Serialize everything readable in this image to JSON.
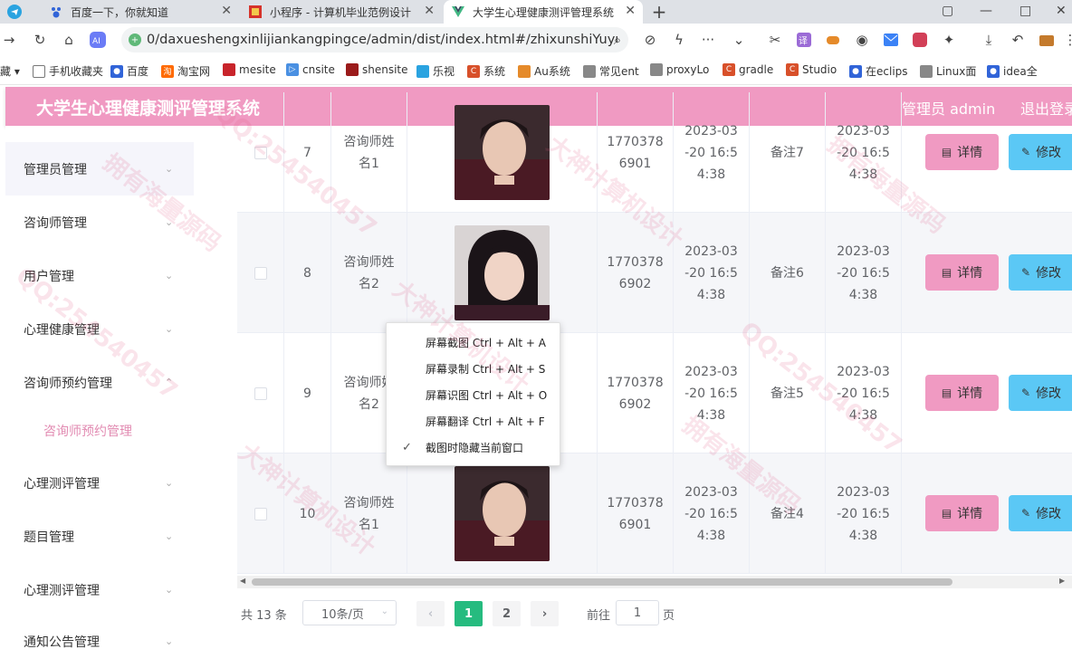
{
  "browser": {
    "tabs": [
      {
        "title": "百度一下，你就知道"
      },
      {
        "title": "小程序 - 计算机毕业范例设计"
      },
      {
        "title": "大学生心理健康测评管理系统"
      }
    ],
    "url": "0/daxueshengxinlijiankangpingce/admin/dist/index.html#/zhixunshiYuyue",
    "bookmarks": [
      "藏",
      "手机收藏夹",
      "百度",
      "淘宝网",
      "mesite",
      "cnsite",
      "shensite",
      "乐视",
      "系统",
      "Au系统",
      "常见ent",
      "proxyLo",
      "gradle",
      "Studio",
      "在eclips",
      "Linux面",
      "idea全"
    ],
    "translate_label": "译"
  },
  "header": {
    "title": "大学生心理健康测评管理系统",
    "admin": "管理员 admin",
    "logout": "退出登录"
  },
  "sidebar": {
    "items": [
      {
        "label": "管理员管理"
      },
      {
        "label": "咨询师管理"
      },
      {
        "label": "用户管理"
      },
      {
        "label": "心理健康管理"
      },
      {
        "label": "咨询师预约管理"
      },
      {
        "label": "咨询师预约管理"
      },
      {
        "label": "心理测评管理"
      },
      {
        "label": "题目管理"
      },
      {
        "label": "心理测评管理"
      },
      {
        "label": "通知公告管理"
      }
    ]
  },
  "table": {
    "rows": [
      {
        "index": "7",
        "name_line1": "咨询师姓",
        "name_line2": "名1",
        "phone_line1": "1770378",
        "phone_line2": "6901",
        "date1_line1": "2023-03",
        "date1_line2": "-20 16:5",
        "date1_line3": "4:38",
        "note": "备注7",
        "date2_line1": "2023-03",
        "date2_line2": "-20 16:5",
        "date2_line3": "4:38"
      },
      {
        "index": "8",
        "name_line1": "咨询师姓",
        "name_line2": "名2",
        "phone_line1": "1770378",
        "phone_line2": "6902",
        "date1_line1": "2023-03",
        "date1_line2": "-20 16:5",
        "date1_line3": "4:38",
        "note": "备注6",
        "date2_line1": "2023-03",
        "date2_line2": "-20 16:5",
        "date2_line3": "4:38"
      },
      {
        "index": "9",
        "name_line1": "咨询师姓",
        "name_line2": "名2",
        "phone_line1": "1770378",
        "phone_line2": "6902",
        "date1_line1": "2023-03",
        "date1_line2": "-20 16:5",
        "date1_line3": "4:38",
        "note": "备注5",
        "date2_line1": "2023-03",
        "date2_line2": "-20 16:5",
        "date2_line3": "4:38"
      },
      {
        "index": "10",
        "name_line1": "咨询师姓",
        "name_line2": "名1",
        "phone_line1": "1770378",
        "phone_line2": "6901",
        "date1_line1": "2023-03",
        "date1_line2": "-20 16:5",
        "date1_line3": "4:38",
        "note": "备注4",
        "date2_line1": "2023-03",
        "date2_line2": "-20 16:5",
        "date2_line3": "4:38"
      }
    ],
    "detail_label": "详情",
    "edit_label": "修改"
  },
  "pagination": {
    "total": "共 13 条",
    "page_size": "10条/页",
    "pages": [
      "1",
      "2"
    ],
    "current": "1",
    "goto_label": "前往",
    "goto_value": "1",
    "goto_unit": "页"
  },
  "context_menu": {
    "items": [
      "屏幕截图 Ctrl + Alt + A",
      "屏幕录制 Ctrl + Alt + S",
      "屏幕识图 Ctrl + Alt + O",
      "屏幕翻译 Ctrl + Alt + F",
      "截图时隐藏当前窗口"
    ]
  },
  "watermark": {
    "lines": [
      "拥有海量源码",
      "QQ:254540457",
      "大神计算机设计"
    ]
  },
  "colors": {
    "brand_pink": "#f09ac2",
    "edit_blue": "#5bc8f5",
    "pager_green": "#26bb7f",
    "submenu_pink": "#e28bb2"
  }
}
